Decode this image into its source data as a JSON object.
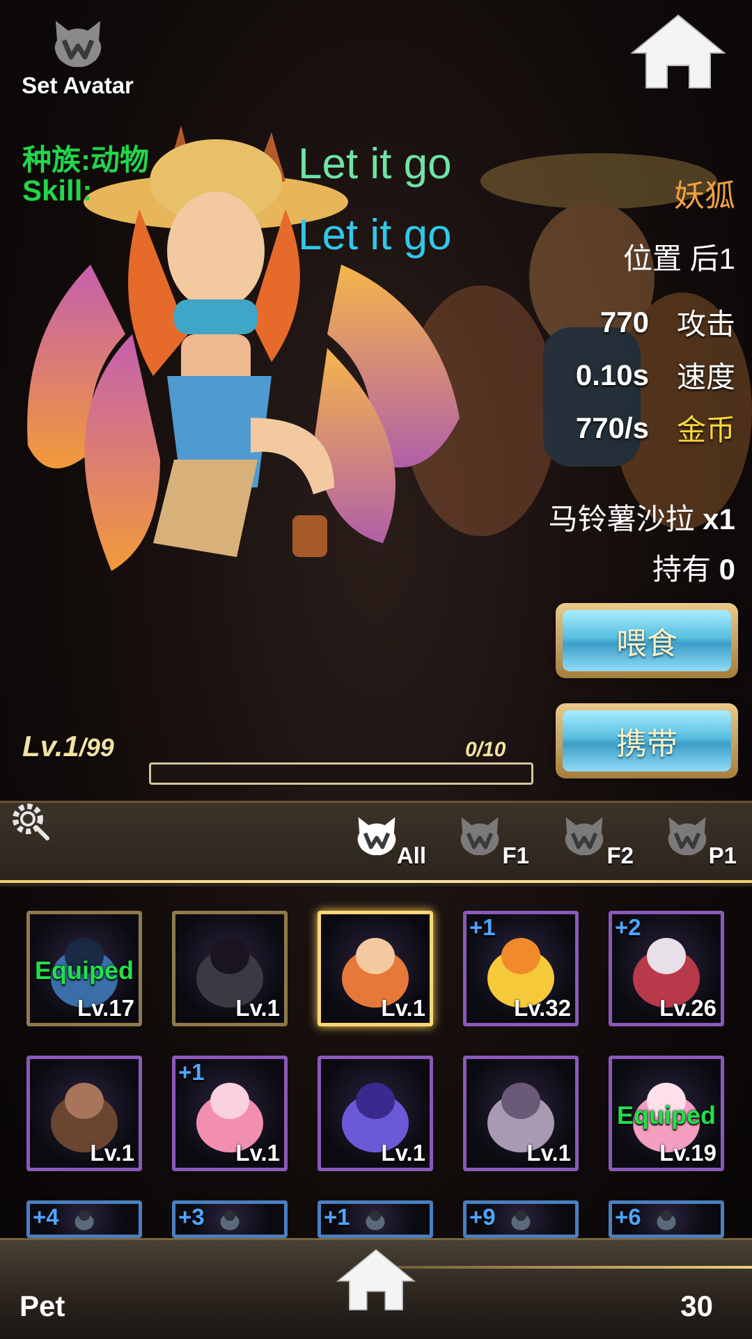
{
  "header": {
    "avatar_label": "Set Avatar"
  },
  "pet_info": {
    "race": "种族:动物",
    "skill": "Skill:",
    "motto_1": "Let it go",
    "motto_2": "Let it go",
    "name": "妖狐",
    "position": "位置 后1"
  },
  "stats": [
    {
      "value": "770",
      "label": "攻击",
      "label_color": "#ffffff"
    },
    {
      "value": "0.10s",
      "label": "速度",
      "label_color": "#ffffff"
    },
    {
      "value": "770/s",
      "label": "金币",
      "label_color": "#f6d73a"
    }
  ],
  "food": {
    "item": "马铃薯沙拉",
    "qty": "x1",
    "hold_label": "持有",
    "hold_value": "0"
  },
  "buttons": {
    "feed": "喂食",
    "carry": "携带"
  },
  "level": {
    "current": "Lv.1",
    "max": "/99",
    "exp_text": "0/10",
    "exp_fraction": 0
  },
  "filters": [
    {
      "label": "All"
    },
    {
      "label": "F1"
    },
    {
      "label": "F2"
    },
    {
      "label": "P1"
    }
  ],
  "pets": [
    {
      "level": "Lv.17",
      "plus": "",
      "equipped": "Equiped",
      "frame": "gold",
      "art": "knight-icon"
    },
    {
      "level": "Lv.1",
      "plus": "",
      "equipped": "",
      "frame": "gold",
      "art": "dark-witch-icon"
    },
    {
      "level": "Lv.1",
      "plus": "",
      "equipped": "",
      "frame": "selected",
      "art": "fox-girl-icon"
    },
    {
      "level": "Lv.32",
      "plus": "+1",
      "equipped": "",
      "frame": "purple",
      "art": "duck-icon"
    },
    {
      "level": "Lv.26",
      "plus": "+2",
      "equipped": "",
      "frame": "purple",
      "art": "red-hood-icon"
    },
    {
      "level": "Lv.1",
      "plus": "",
      "equipped": "",
      "frame": "purple",
      "art": "bat-boar-icon"
    },
    {
      "level": "Lv.1",
      "plus": "+1",
      "equipped": "",
      "frame": "purple",
      "art": "pink-slime-icon"
    },
    {
      "level": "Lv.1",
      "plus": "",
      "equipped": "",
      "frame": "purple",
      "art": "purple-slime-icon"
    },
    {
      "level": "Lv.1",
      "plus": "",
      "equipped": "",
      "frame": "purple",
      "art": "mummy-icon"
    },
    {
      "level": "Lv.19",
      "plus": "",
      "equipped": "Equiped",
      "frame": "purple",
      "art": "angel-slime-icon"
    },
    {
      "level": "",
      "plus": "+4",
      "equipped": "",
      "frame": "blue",
      "art": "pet-icon"
    },
    {
      "level": "",
      "plus": "+3",
      "equipped": "",
      "frame": "blue",
      "art": "pet-icon"
    },
    {
      "level": "",
      "plus": "+1",
      "equipped": "",
      "frame": "blue",
      "art": "pet-icon"
    },
    {
      "level": "",
      "plus": "+9",
      "equipped": "",
      "frame": "blue",
      "art": "pet-icon"
    },
    {
      "level": "",
      "plus": "+6",
      "equipped": "",
      "frame": "blue",
      "art": "pet-icon"
    }
  ],
  "footer": {
    "label": "Pet",
    "count": "30"
  }
}
